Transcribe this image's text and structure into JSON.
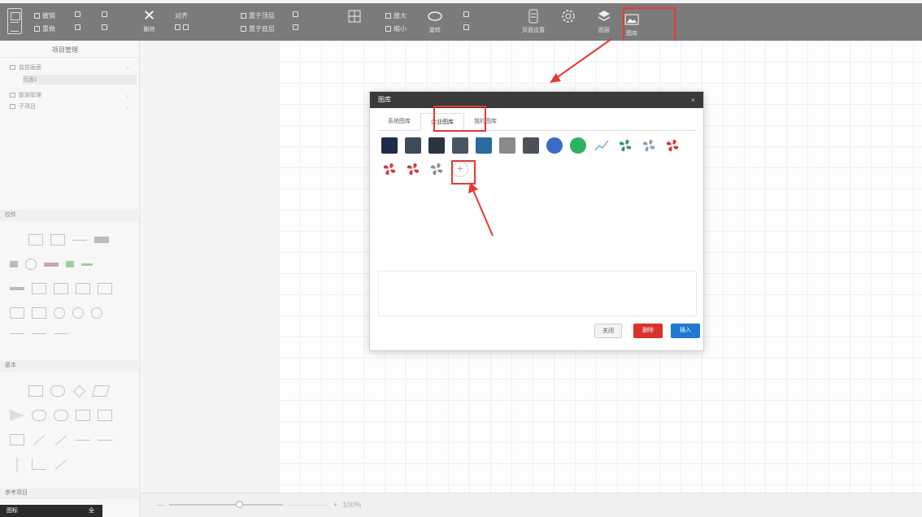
{
  "toolbar": {
    "highlight_color": "#e53935",
    "items": [
      {
        "label": "撤销",
        "icon": "undo-icon"
      },
      {
        "label": "重做",
        "icon": "redo-icon"
      },
      {
        "label": "删除",
        "icon": "delete-icon"
      },
      {
        "label": "置于顶层",
        "icon": "bring-to-front-icon"
      },
      {
        "label": "置于底层",
        "icon": "send-to-back-icon"
      },
      {
        "label": "对齐",
        "icon": "align-icon"
      },
      {
        "label": "放大",
        "icon": "zoom-in-icon"
      },
      {
        "label": "缩小",
        "icon": "zoom-out-icon"
      },
      {
        "label": "旋转",
        "icon": "rotate-icon"
      },
      {
        "label": "页面设置",
        "icon": "page-settings-icon"
      },
      {
        "label": "图层",
        "icon": "layers-icon"
      },
      {
        "label": "图库",
        "icon": "gallery-icon"
      }
    ]
  },
  "sidebar": {
    "title": "项目管理",
    "tree": [
      {
        "label": "监控画面",
        "icon": "folder-icon"
      },
      {
        "label": "页面1",
        "icon": ""
      },
      {
        "label": "能源管理",
        "icon": "folder-icon"
      },
      {
        "label": "子项目",
        "icon": "folder-icon"
      }
    ],
    "sections": {
      "controls": "控件",
      "basic": "基本",
      "reference": "参考项目"
    },
    "bottom": {
      "left": "图标",
      "right": "全"
    }
  },
  "zoom": {
    "value": "100%",
    "minus": "—",
    "plus": "+"
  },
  "dialog": {
    "title": "图库",
    "close": "×",
    "tabs": [
      {
        "label": "系统图库",
        "active": false
      },
      {
        "label": "企业图库",
        "active": true
      },
      {
        "label": "我的图库",
        "active": false
      }
    ],
    "images": [
      {
        "name": "night-scene-image",
        "color": "#1d2c4a"
      },
      {
        "name": "server-room-image",
        "color": "#3b4b5c"
      },
      {
        "name": "machine-image",
        "color": "#2a3540"
      },
      {
        "name": "cabinet-image",
        "color": "#4a5560"
      },
      {
        "name": "panel-image",
        "color": "#2b6ba0"
      },
      {
        "name": "cable-image",
        "color": "#8a8a8a"
      },
      {
        "name": "camera-image",
        "color": "#4d5258"
      },
      {
        "name": "globe-image",
        "color": "#3a6bc6"
      },
      {
        "name": "green-dial-image",
        "color": "#2bb361"
      },
      {
        "name": "line-chart-image",
        "color": "#6fb1e8"
      },
      {
        "name": "fan-teal-image",
        "color": "#3a8f8a"
      },
      {
        "name": "fan-grey-image",
        "color": "#8fa0b0"
      },
      {
        "name": "fan-red-image",
        "color": "#d9363e"
      },
      {
        "name": "fan-red-2-image",
        "color": "#d9363e"
      },
      {
        "name": "fan-red-3-image",
        "color": "#d9363e"
      },
      {
        "name": "fan-grey-2-image",
        "color": "#909090"
      }
    ],
    "add_label": "+",
    "buttons": {
      "close": "关闭",
      "delete": "删除",
      "insert": "插入"
    }
  }
}
